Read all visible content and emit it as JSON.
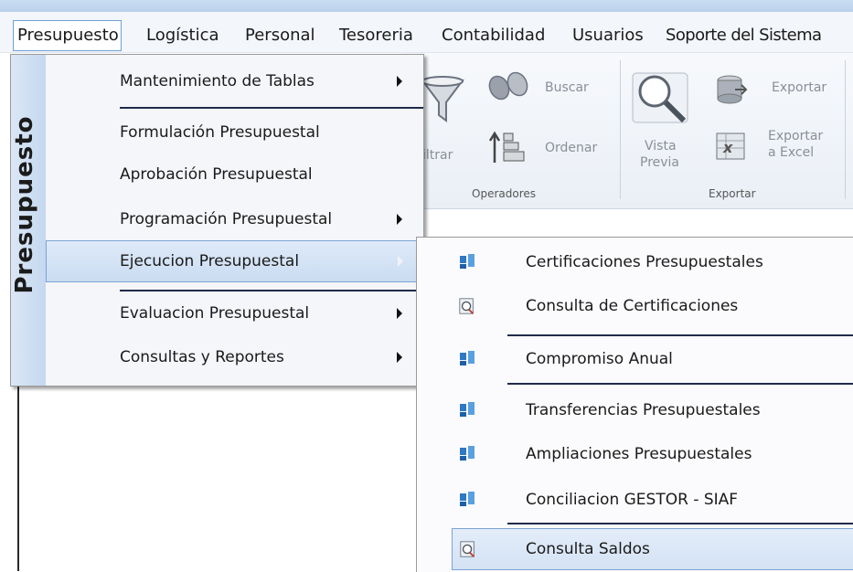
{
  "menubar": {
    "items": [
      "Presupuesto",
      "Logística",
      "Personal",
      "Tesoreria",
      "Contabilidad",
      "Usuarios",
      "Soporte del Sistema"
    ]
  },
  "ribbon": {
    "buscar": "Buscar",
    "filtrar": "iltrar",
    "ordenar": "Ordenar",
    "operadores": "Operadores",
    "vista": "Vista",
    "previa": "Previa",
    "exportar": "Exportar",
    "exportar_a": "Exportar",
    "a_excel": "a Excel",
    "exportar_group": "Exportar"
  },
  "menu": {
    "vertical_label": "Presupuesto",
    "items": [
      {
        "label": "Mantenimiento de Tablas",
        "submenu": true
      },
      {
        "label": "Formulación Presupuestal",
        "submenu": false
      },
      {
        "label": "Aprobación Presupuestal",
        "submenu": false
      },
      {
        "label": "Programación Presupuestal",
        "submenu": true
      },
      {
        "label": "Ejecucion Presupuestal",
        "submenu": true,
        "highlighted": true
      },
      {
        "label": "Evaluacion Presupuestal",
        "submenu": true
      },
      {
        "label": "Consultas y Reportes",
        "submenu": true
      }
    ]
  },
  "submenu": {
    "items": [
      {
        "label": "Certificaciones Presupuestales",
        "icon": "blue-doc-icon"
      },
      {
        "label": "Consulta de Certificaciones",
        "icon": "search-doc-icon"
      },
      {
        "label": "Compromiso Anual",
        "icon": "blue-doc-icon"
      },
      {
        "label": "Transferencias Presupuestales",
        "icon": "blue-doc-icon"
      },
      {
        "label": "Ampliaciones Presupuestales",
        "icon": "blue-doc-icon"
      },
      {
        "label": "Conciliacion GESTOR - SIAF",
        "icon": "blue-doc-icon"
      },
      {
        "label": "Consulta Saldos",
        "icon": "search-doc-icon",
        "highlighted": true
      }
    ]
  }
}
